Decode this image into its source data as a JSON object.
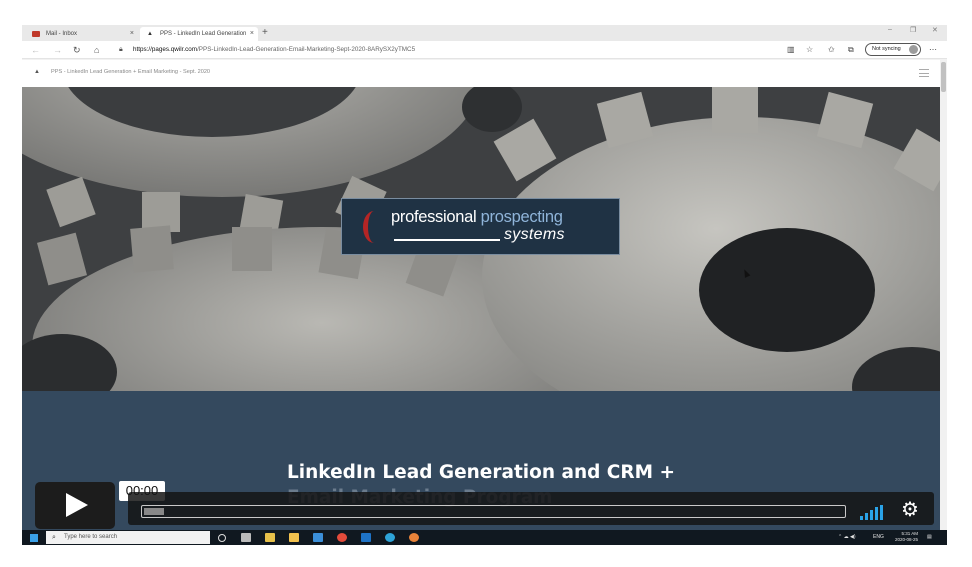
{
  "browser": {
    "tabs": [
      {
        "label": "Mail - Inbox",
        "close": "×"
      },
      {
        "label": "PPS - LinkedIn Lead Generation",
        "close": "×"
      }
    ],
    "new_tab": "+",
    "url_host": "https://pages.qwilr.com",
    "url_path": "/PPS-LinkedIn-Lead-Generation-Email-Marketing-Sept-2020-8ARySX2yTMC5",
    "sync_label": "Not syncing"
  },
  "page": {
    "header_title": "PPS - LinkedIn Lead Generation + Email Marketing - Sept. 2020",
    "logo": {
      "word1": "professional",
      "word2": "prospecting",
      "word3": "systems"
    },
    "headline_line1": "LinkedIn Lead Generation and CRM +",
    "headline_line2": "Email Marketing Program"
  },
  "video": {
    "time": "00:00",
    "progress": 0.0
  },
  "taskbar": {
    "search_placeholder": "Type here to search",
    "language": "ENG",
    "time": "5:31 AM",
    "date": "2020-08-25"
  }
}
